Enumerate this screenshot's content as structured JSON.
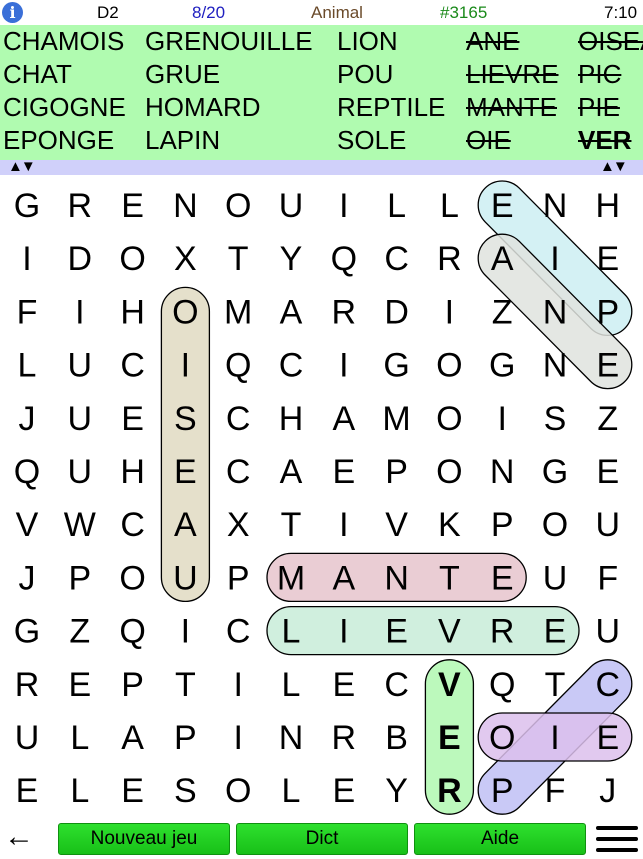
{
  "header": {
    "info_icon": "info-icon",
    "level": "D2",
    "progress": "8/20",
    "theme": "Animal",
    "puzzle_id": "#3165",
    "timer": "7:10",
    "colors": {
      "progress": "#2020c0",
      "theme": "#6a4a2a",
      "puzzle_id": "#1a8a1a"
    }
  },
  "word_list": [
    {
      "text": "CHAMOIS",
      "found": false
    },
    {
      "text": "CHAT",
      "found": false
    },
    {
      "text": "CIGOGNE",
      "found": false
    },
    {
      "text": "EPONGE",
      "found": false
    },
    {
      "text": "GRENOUILLE",
      "found": false
    },
    {
      "text": "GRUE",
      "found": false
    },
    {
      "text": "HOMARD",
      "found": false
    },
    {
      "text": "LAPIN",
      "found": false
    },
    {
      "text": "LION",
      "found": false
    },
    {
      "text": "POU",
      "found": false
    },
    {
      "text": "REPTILE",
      "found": false
    },
    {
      "text": "SOLE",
      "found": false
    },
    {
      "text": "ANE",
      "found": true
    },
    {
      "text": "LIEVRE",
      "found": true
    },
    {
      "text": "MANTE",
      "found": true
    },
    {
      "text": "OIE",
      "found": true
    },
    {
      "text": "OISEAU",
      "found": true
    },
    {
      "text": "PIC",
      "found": true
    },
    {
      "text": "PIE",
      "found": true
    },
    {
      "text": "VER",
      "found": true,
      "last": true
    }
  ],
  "grid": [
    "GRENOUILLENH",
    "IDOXTYQCRAIE",
    "FIHOMARDIZNP",
    "LUCIQCIGOGNE",
    "JUESCHAMOISZ",
    "QUHECAEPONGE",
    "VWCAXTIVKPOU",
    "JPOUPMANTEUF",
    "GZQICLIEVREU",
    "REPTILECVQTC",
    "ULAPINRBEOIE",
    "ELESOLEYRPFJ"
  ],
  "highlights": [
    {
      "word": "PIE",
      "from": [
        0,
        9
      ],
      "to": [
        2,
        11
      ],
      "color": "#cdeef2"
    },
    {
      "word": "ANE",
      "from": [
        1,
        9
      ],
      "to": [
        3,
        11
      ],
      "color": "#dfe3de"
    },
    {
      "word": "OISEAU",
      "from": [
        2,
        3
      ],
      "to": [
        7,
        3
      ],
      "color": "#e0dac2"
    },
    {
      "word": "MANTE",
      "from": [
        7,
        5
      ],
      "to": [
        7,
        9
      ],
      "color": "#e6c4cc"
    },
    {
      "word": "LIEVRE",
      "from": [
        8,
        5
      ],
      "to": [
        8,
        10
      ],
      "color": "#c8ecd8"
    },
    {
      "word": "VER",
      "from": [
        9,
        8
      ],
      "to": [
        11,
        8
      ],
      "color": "#b0f8b0",
      "bold": true
    },
    {
      "word": "PIC",
      "from": [
        11,
        9
      ],
      "to": [
        9,
        11
      ],
      "color": "#c0c0f4"
    },
    {
      "word": "OIE",
      "from": [
        10,
        9
      ],
      "to": [
        10,
        11
      ],
      "color": "#dcc0ec"
    }
  ],
  "bottom": {
    "back_icon": "arrow-left-icon",
    "buttons": [
      "Nouveau jeu",
      "Dict",
      "Aide"
    ],
    "menu_icon": "hamburger-menu-icon"
  },
  "scroll_arrows": "▲▼"
}
